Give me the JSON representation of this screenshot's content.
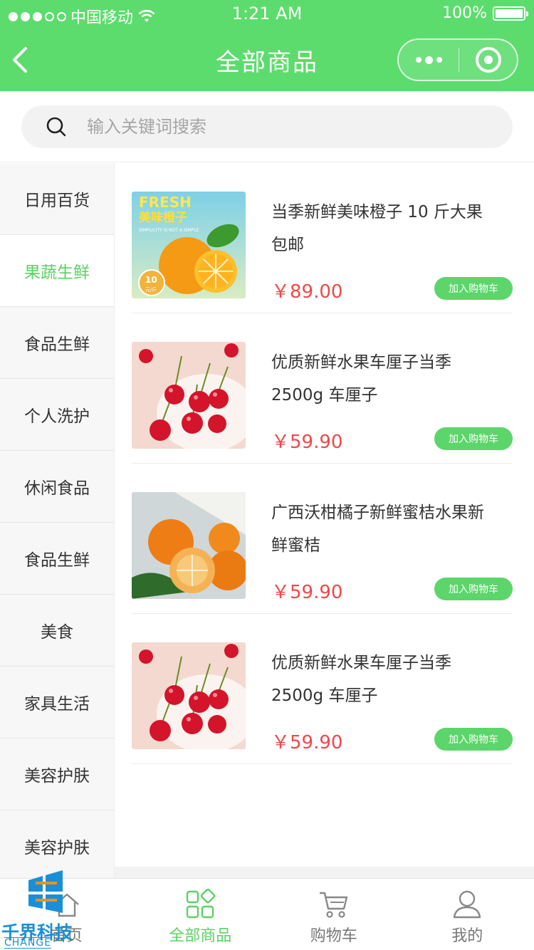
{
  "status_bar": {
    "carrier": "中国移动",
    "time": "1:21 AM",
    "battery": "100%"
  },
  "nav": {
    "title": "全部商品"
  },
  "search": {
    "placeholder": "输入关键词搜索"
  },
  "categories": [
    {
      "label": "日用百货"
    },
    {
      "label": "果蔬生鲜"
    },
    {
      "label": "食品生鲜"
    },
    {
      "label": "个人洗护"
    },
    {
      "label": "休闲食品"
    },
    {
      "label": "食品生鲜"
    },
    {
      "label": "美食"
    },
    {
      "label": "家具生活"
    },
    {
      "label": "美容护肤"
    },
    {
      "label": "美容护肤"
    }
  ],
  "active_category": "果蔬生鲜",
  "products": [
    {
      "title": "当季新鲜美味橙子 10 斤大果包邮",
      "price": "￥89.00",
      "button": "加入购物车",
      "image": "orange-promo",
      "image_text": {
        "fresh": "FRESH",
        "name": "美味橙子",
        "slogan": "SIMPLICITY IS NOT A SIMPLE",
        "weight": "10",
        "unit": "元/斤"
      }
    },
    {
      "title": "优质新鲜水果车厘子当季2500g 车厘子",
      "price": "￥59.90",
      "button": "加入购物车",
      "image": "cherries"
    },
    {
      "title": "广西沃柑橘子新鲜蜜桔水果新鲜蜜桔",
      "price": "￥59.90",
      "button": "加入购物车",
      "image": "tangerines"
    },
    {
      "title": "优质新鲜水果车厘子当季2500g 车厘子",
      "price": "￥59.90",
      "button": "加入购物车",
      "image": "cherries"
    }
  ],
  "tabbar": [
    {
      "label": "首页",
      "icon": "home-icon"
    },
    {
      "label": "全部商品",
      "icon": "grid-icon",
      "active": true
    },
    {
      "label": "购物车",
      "icon": "cart-icon"
    },
    {
      "label": "我的",
      "icon": "user-icon"
    }
  ],
  "watermark": {
    "text": "千界科技",
    "sub": "CHANGE"
  },
  "colors": {
    "brand_green": "#5cdc6d",
    "price_red": "#f04848",
    "active_text": "#5cd165"
  }
}
